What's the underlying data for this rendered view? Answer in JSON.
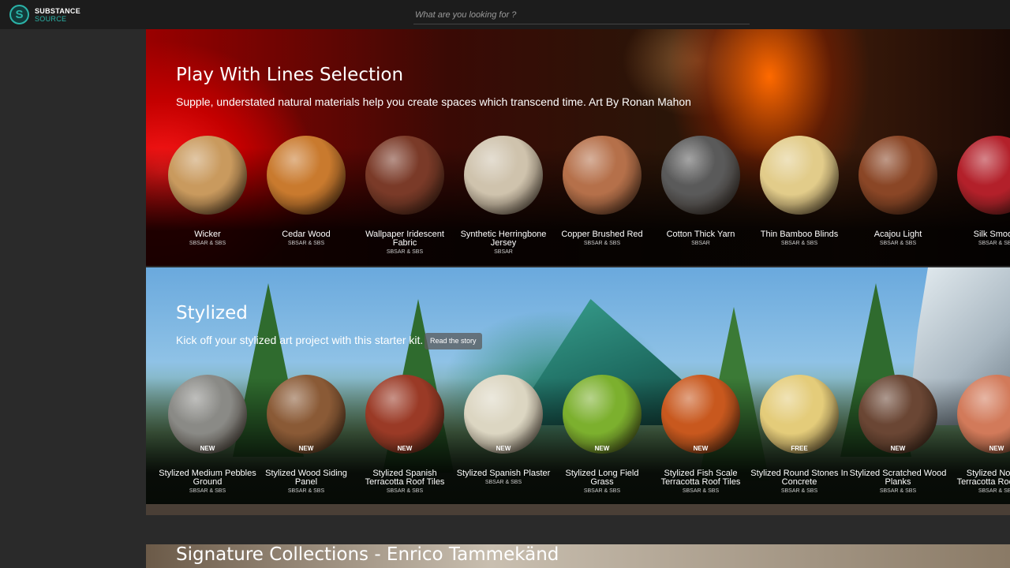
{
  "logo": {
    "line1": "SUBSTANCE",
    "line2": "SOURCE"
  },
  "search": {
    "placeholder": "What are you looking for ?"
  },
  "sections": [
    {
      "title": "Play With Lines Selection",
      "subtitle": "Supple, understated natural materials help you create spaces which transcend time. Art By Ronan Mahon",
      "items": [
        {
          "name": "Wicker",
          "format": "SBSAR & SBS",
          "color": "#c99a5e"
        },
        {
          "name": "Cedar Wood",
          "format": "SBSAR & SBS",
          "color": "#c97a2e"
        },
        {
          "name": "Wallpaper Iridescent Fabric",
          "format": "SBSAR & SBS",
          "color": "#7a3a28"
        },
        {
          "name": "Synthetic Herringbone Jersey",
          "format": "SBSAR",
          "color": "#cfc3ad"
        },
        {
          "name": "Copper Brushed Red",
          "format": "SBSAR & SBS",
          "color": "#b5704a"
        },
        {
          "name": "Cotton Thick Yarn",
          "format": "SBSAR",
          "color": "#5a5a5a"
        },
        {
          "name": "Thin Bamboo Blinds",
          "format": "SBSAR & SBS",
          "color": "#e2cc8a"
        },
        {
          "name": "Acajou Light",
          "format": "SBSAR & SBS",
          "color": "#8a4626"
        },
        {
          "name": "Silk Smooth",
          "format": "SBSAR & SBS",
          "color": "#b3202a"
        }
      ]
    },
    {
      "title": "Stylized",
      "subtitle": "Kick off your stylized art project with this starter kit.",
      "button": "Read the story",
      "items": [
        {
          "name": "Stylized Medium Pebbles Ground",
          "format": "SBSAR & SBS",
          "badge": "NEW",
          "color": "#8a8a86"
        },
        {
          "name": "Stylized Wood Siding Panel",
          "format": "SBSAR & SBS",
          "badge": "NEW",
          "color": "#8a5a36"
        },
        {
          "name": "Stylized Spanish Terracotta Roof Tiles",
          "format": "SBSAR & SBS",
          "badge": "NEW",
          "color": "#9a3a26"
        },
        {
          "name": "Stylized Spanish Plaster",
          "format": "SBSAR & SBS",
          "badge": "NEW",
          "color": "#dcd6c2"
        },
        {
          "name": "Stylized Long Field Grass",
          "format": "SBSAR & SBS",
          "badge": "NEW",
          "color": "#7cb02e"
        },
        {
          "name": "Stylized Fish Scale Terracotta Roof Tiles",
          "format": "SBSAR & SBS",
          "badge": "NEW",
          "color": "#c8581e"
        },
        {
          "name": "Stylized Round Stones In Concrete",
          "format": "SBSAR & SBS",
          "badge": "FREE",
          "color": "#e4cc7a"
        },
        {
          "name": "Stylized Scratched Wood Planks",
          "format": "SBSAR & SBS",
          "badge": "NEW",
          "color": "#6a4634"
        },
        {
          "name": "Stylized Norfolk Terracotta Roof Tiles",
          "format": "SBSAR & SBS",
          "badge": "NEW",
          "color": "#d27a5a"
        }
      ]
    }
  ],
  "signature": {
    "title": "Signature Collections - Enrico Tammekänd"
  }
}
